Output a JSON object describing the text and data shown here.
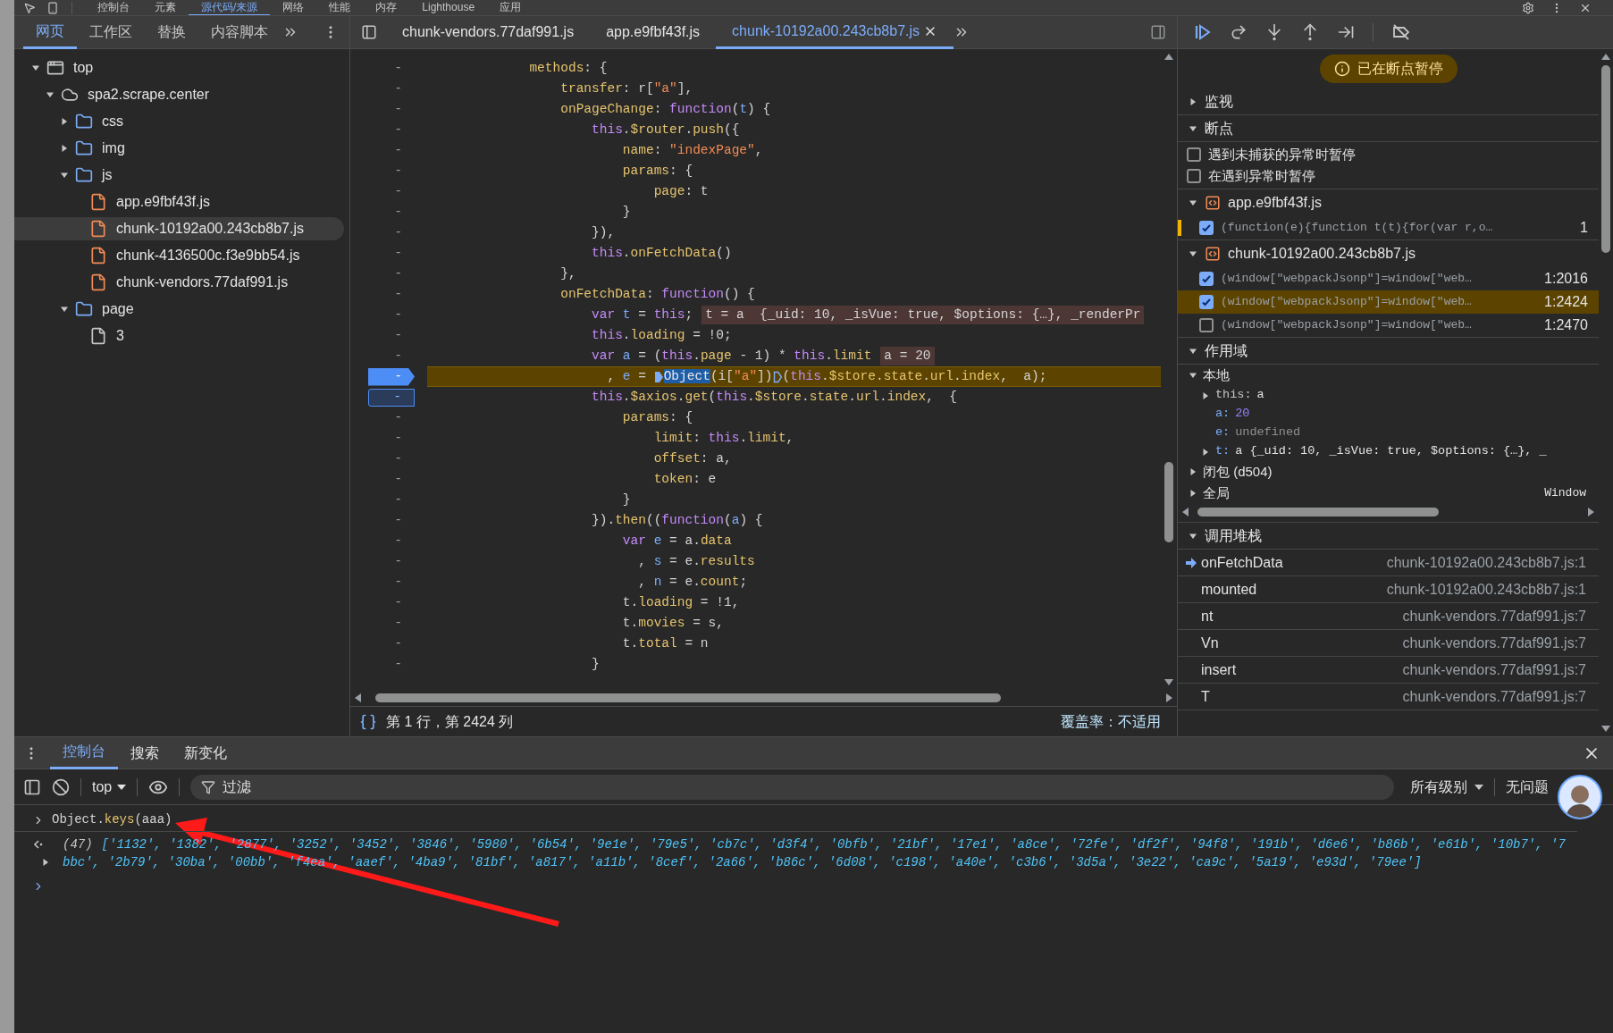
{
  "topbar": {
    "tabs": [
      {
        "label": "控制台",
        "selected": false
      },
      {
        "label": "元素",
        "selected": false
      },
      {
        "label": "源代码/来源",
        "selected": true
      },
      {
        "label": "网络",
        "selected": false
      },
      {
        "label": "性能",
        "selected": false
      },
      {
        "label": "内存",
        "selected": false
      },
      {
        "label": "Lighthouse",
        "selected": false
      },
      {
        "label": "应用",
        "selected": false
      }
    ]
  },
  "navigator": {
    "tabs": [
      {
        "label": "网页",
        "selected": true
      },
      {
        "label": "工作区",
        "selected": false
      },
      {
        "label": "替换",
        "selected": false
      },
      {
        "label": "内容脚本",
        "selected": false
      }
    ],
    "tree": [
      {
        "label": "top",
        "kind": "frame",
        "expanded": true,
        "selected": false,
        "children": [
          {
            "label": "spa2.scrape.center",
            "kind": "domain",
            "expanded": true,
            "selected": false,
            "children": [
              {
                "label": "css",
                "kind": "folder",
                "expanded": false,
                "selected": false
              },
              {
                "label": "img",
                "kind": "folder",
                "expanded": false,
                "selected": false
              },
              {
                "label": "js",
                "kind": "folder",
                "expanded": true,
                "selected": false,
                "children": [
                  {
                    "label": "app.e9fbf43f.js",
                    "kind": "script",
                    "selected": false
                  },
                  {
                    "label": "chunk-10192a00.243cb8b7.js",
                    "kind": "script",
                    "selected": true
                  },
                  {
                    "label": "chunk-4136500c.f3e9bb54.js",
                    "kind": "script",
                    "selected": false
                  },
                  {
                    "label": "chunk-vendors.77daf991.js",
                    "kind": "script",
                    "selected": false
                  }
                ]
              },
              {
                "label": "page",
                "kind": "folder",
                "expanded": true,
                "selected": false,
                "children": [
                  {
                    "label": "3",
                    "kind": "document",
                    "selected": false
                  }
                ]
              }
            ]
          }
        ]
      }
    ]
  },
  "editor": {
    "tabs": [
      {
        "label": "chunk-vendors.77daf991.js",
        "selected": false
      },
      {
        "label": "app.e9fbf43f.js",
        "selected": false
      },
      {
        "label": "chunk-10192a00.243cb8b7.js",
        "selected": true
      }
    ],
    "lines": [
      {
        "gutter": "-",
        "paused": false,
        "tokens": [
          {
            "text": "            methods",
            "kind": "prop"
          },
          {
            "text": ": {",
            "kind": "plain"
          }
        ]
      },
      {
        "gutter": "-",
        "paused": false,
        "tokens": [
          {
            "text": "                transfer",
            "kind": "prop"
          },
          {
            "text": ": r[",
            "kind": "plain"
          },
          {
            "text": "\"a\"",
            "kind": "string"
          },
          {
            "text": "],",
            "kind": "plain"
          }
        ]
      },
      {
        "gutter": "-",
        "paused": false,
        "tokens": [
          {
            "text": "                onPageChange",
            "kind": "prop"
          },
          {
            "text": ": ",
            "kind": "plain"
          },
          {
            "text": "function",
            "kind": "keyword"
          },
          {
            "text": "(",
            "kind": "plain"
          },
          {
            "text": "t",
            "kind": "variable"
          },
          {
            "text": ") {",
            "kind": "plain"
          }
        ]
      },
      {
        "gutter": "-",
        "paused": false,
        "tokens": [
          {
            "text": "                    this",
            "kind": "keyword"
          },
          {
            "text": ".",
            "kind": "plain"
          },
          {
            "text": "$router",
            "kind": "prop"
          },
          {
            "text": ".",
            "kind": "plain"
          },
          {
            "text": "push",
            "kind": "prop"
          },
          {
            "text": "({",
            "kind": "plain"
          }
        ]
      },
      {
        "gutter": "-",
        "paused": false,
        "tokens": [
          {
            "text": "                        name",
            "kind": "prop"
          },
          {
            "text": ": ",
            "kind": "plain"
          },
          {
            "text": "\"indexPage\"",
            "kind": "string"
          },
          {
            "text": ",",
            "kind": "plain"
          }
        ]
      },
      {
        "gutter": "-",
        "paused": false,
        "tokens": [
          {
            "text": "                        params",
            "kind": "prop"
          },
          {
            "text": ": {",
            "kind": "plain"
          }
        ]
      },
      {
        "gutter": "-",
        "paused": false,
        "tokens": [
          {
            "text": "                            page",
            "kind": "prop"
          },
          {
            "text": ": t",
            "kind": "plain"
          }
        ]
      },
      {
        "gutter": "-",
        "paused": false,
        "tokens": [
          {
            "text": "                        }",
            "kind": "plain"
          }
        ]
      },
      {
        "gutter": "-",
        "paused": false,
        "tokens": [
          {
            "text": "                    }),",
            "kind": "plain"
          }
        ]
      },
      {
        "gutter": "-",
        "paused": false,
        "tokens": [
          {
            "text": "                    this",
            "kind": "keyword"
          },
          {
            "text": ".",
            "kind": "plain"
          },
          {
            "text": "onFetchData",
            "kind": "prop"
          },
          {
            "text": "()",
            "kind": "plain"
          }
        ]
      },
      {
        "gutter": "-",
        "paused": false,
        "tokens": [
          {
            "text": "                },",
            "kind": "plain"
          }
        ]
      },
      {
        "gutter": "-",
        "paused": false,
        "tokens": [
          {
            "text": "                onFetchData",
            "kind": "prop"
          },
          {
            "text": ": ",
            "kind": "plain"
          },
          {
            "text": "function",
            "kind": "keyword"
          },
          {
            "text": "() {",
            "kind": "plain"
          }
        ]
      },
      {
        "gutter": "-",
        "paused": false,
        "tokens": [
          {
            "text": "                    var",
            "kind": "keyword"
          },
          {
            "text": " t",
            "kind": "variable"
          },
          {
            "text": " = ",
            "kind": "plain"
          },
          {
            "text": "this",
            "kind": "keyword"
          },
          {
            "text": ";",
            "kind": "plain"
          },
          {
            "text": "t = a  {_uid: 10, _isVue: true, $options: {…}, _renderPr",
            "kind": "inline"
          }
        ]
      },
      {
        "gutter": "-",
        "paused": false,
        "tokens": [
          {
            "text": "                    this",
            "kind": "keyword"
          },
          {
            "text": ".",
            "kind": "plain"
          },
          {
            "text": "loading",
            "kind": "prop"
          },
          {
            "text": " = !0;",
            "kind": "plain"
          }
        ]
      },
      {
        "gutter": "-",
        "paused": false,
        "tokens": [
          {
            "text": "                    var",
            "kind": "keyword"
          },
          {
            "text": " a",
            "kind": "variable"
          },
          {
            "text": " = (",
            "kind": "plain"
          },
          {
            "text": "this",
            "kind": "keyword"
          },
          {
            "text": ".",
            "kind": "plain"
          },
          {
            "text": "page",
            "kind": "prop"
          },
          {
            "text": " - 1) * ",
            "kind": "plain"
          },
          {
            "text": "this",
            "kind": "keyword"
          },
          {
            "text": ".",
            "kind": "plain"
          },
          {
            "text": "limit",
            "kind": "prop"
          },
          {
            "text": "a = 20",
            "kind": "inline"
          }
        ]
      },
      {
        "gutter": "-",
        "breakpoint_enabled": true,
        "paused": true,
        "tokens": [
          {
            "text": "                      , ",
            "kind": "plain"
          },
          {
            "text": "e",
            "kind": "variable"
          },
          {
            "text": " = ",
            "kind": "plain"
          },
          {
            "kind": "marker",
            "active": true
          },
          {
            "text": "Object",
            "kind": "selected"
          },
          {
            "text": "(i[",
            "kind": "plain"
          },
          {
            "text": "\"a\"",
            "kind": "string"
          },
          {
            "text": "])",
            "kind": "plain"
          },
          {
            "kind": "marker",
            "active": false
          },
          {
            "text": "(",
            "kind": "plain"
          },
          {
            "text": "this",
            "kind": "keyword"
          },
          {
            "text": ".",
            "kind": "plain"
          },
          {
            "text": "$store",
            "kind": "prop"
          },
          {
            "text": ".",
            "kind": "plain"
          },
          {
            "text": "state",
            "kind": "prop"
          },
          {
            "text": ".",
            "kind": "plain"
          },
          {
            "text": "url",
            "kind": "prop"
          },
          {
            "text": ".",
            "kind": "plain"
          },
          {
            "text": "index",
            "kind": "prop"
          },
          {
            "text": ",  a);",
            "kind": "plain"
          }
        ]
      },
      {
        "gutter": "-",
        "breakpoint_enabled": false,
        "paused": false,
        "tokens": [
          {
            "text": "                    this",
            "kind": "keyword"
          },
          {
            "text": ".",
            "kind": "plain"
          },
          {
            "text": "$axios",
            "kind": "prop"
          },
          {
            "text": ".",
            "kind": "plain"
          },
          {
            "text": "get",
            "kind": "prop"
          },
          {
            "text": "(",
            "kind": "plain"
          },
          {
            "text": "this",
            "kind": "keyword"
          },
          {
            "text": ".",
            "kind": "plain"
          },
          {
            "text": "$store",
            "kind": "prop"
          },
          {
            "text": ".",
            "kind": "plain"
          },
          {
            "text": "state",
            "kind": "prop"
          },
          {
            "text": ".",
            "kind": "plain"
          },
          {
            "text": "url",
            "kind": "prop"
          },
          {
            "text": ".",
            "kind": "plain"
          },
          {
            "text": "index",
            "kind": "prop"
          },
          {
            "text": ",  {",
            "kind": "plain"
          }
        ]
      },
      {
        "gutter": "-",
        "paused": false,
        "tokens": [
          {
            "text": "                        params",
            "kind": "prop"
          },
          {
            "text": ": {",
            "kind": "plain"
          }
        ]
      },
      {
        "gutter": "-",
        "paused": false,
        "tokens": [
          {
            "text": "                            limit",
            "kind": "prop"
          },
          {
            "text": ": ",
            "kind": "plain"
          },
          {
            "text": "this",
            "kind": "keyword"
          },
          {
            "text": ".",
            "kind": "plain"
          },
          {
            "text": "limit",
            "kind": "prop"
          },
          {
            "text": ",",
            "kind": "plain"
          }
        ]
      },
      {
        "gutter": "-",
        "paused": false,
        "tokens": [
          {
            "text": "                            offset",
            "kind": "prop"
          },
          {
            "text": ": a,",
            "kind": "plain"
          }
        ]
      },
      {
        "gutter": "-",
        "paused": false,
        "tokens": [
          {
            "text": "                            token",
            "kind": "prop"
          },
          {
            "text": ": e",
            "kind": "plain"
          }
        ]
      },
      {
        "gutter": "-",
        "paused": false,
        "tokens": [
          {
            "text": "                        }",
            "kind": "plain"
          }
        ]
      },
      {
        "gutter": "-",
        "paused": false,
        "tokens": [
          {
            "text": "                    }).",
            "kind": "plain"
          },
          {
            "text": "then",
            "kind": "prop"
          },
          {
            "text": "((",
            "kind": "plain"
          },
          {
            "text": "function",
            "kind": "keyword"
          },
          {
            "text": "(",
            "kind": "plain"
          },
          {
            "text": "a",
            "kind": "variable"
          },
          {
            "text": ") {",
            "kind": "plain"
          }
        ]
      },
      {
        "gutter": "-",
        "paused": false,
        "tokens": [
          {
            "text": "                        var",
            "kind": "keyword"
          },
          {
            "text": " e",
            "kind": "variable"
          },
          {
            "text": " = a.",
            "kind": "plain"
          },
          {
            "text": "data",
            "kind": "prop"
          }
        ]
      },
      {
        "gutter": "-",
        "paused": false,
        "tokens": [
          {
            "text": "                          , ",
            "kind": "plain"
          },
          {
            "text": "s",
            "kind": "variable"
          },
          {
            "text": " = e.",
            "kind": "plain"
          },
          {
            "text": "results",
            "kind": "prop"
          }
        ]
      },
      {
        "gutter": "-",
        "paused": false,
        "tokens": [
          {
            "text": "                          , ",
            "kind": "plain"
          },
          {
            "text": "n",
            "kind": "variable"
          },
          {
            "text": " = e.",
            "kind": "plain"
          },
          {
            "text": "count",
            "kind": "prop"
          },
          {
            "text": ";",
            "kind": "plain"
          }
        ]
      },
      {
        "gutter": "-",
        "paused": false,
        "tokens": [
          {
            "text": "                        t.",
            "kind": "plain"
          },
          {
            "text": "loading",
            "kind": "prop"
          },
          {
            "text": " = !1,",
            "kind": "plain"
          }
        ]
      },
      {
        "gutter": "-",
        "paused": false,
        "tokens": [
          {
            "text": "                        t.",
            "kind": "plain"
          },
          {
            "text": "movies",
            "kind": "prop"
          },
          {
            "text": " = s,",
            "kind": "plain"
          }
        ]
      },
      {
        "gutter": "-",
        "paused": false,
        "tokens": [
          {
            "text": "                        t.",
            "kind": "plain"
          },
          {
            "text": "total",
            "kind": "prop"
          },
          {
            "text": " = n",
            "kind": "plain"
          }
        ]
      },
      {
        "gutter": "-",
        "paused": false,
        "tokens": [
          {
            "text": "                    }",
            "kind": "plain"
          }
        ]
      }
    ],
    "status": {
      "position": "第 1 行，第 2424 列",
      "coverage": "覆盖率：不适用"
    }
  },
  "debugger": {
    "paused_badge": "已在断点暂停",
    "watch": {
      "title": "监视",
      "expanded": false
    },
    "breakpoints": {
      "title": "断点",
      "expanded": true,
      "options": [
        {
          "label": "遇到未捕获的异常时暂停",
          "checked": false
        },
        {
          "label": "在遇到异常时暂停",
          "checked": false
        }
      ],
      "files": [
        {
          "name": "app.e9fbf43f.js",
          "expanded": true,
          "items": [
            {
              "code": "(function(e){function t(t){for(var r,o…",
              "location": "1",
              "checked": true,
              "selected": false,
              "marked": true
            }
          ]
        },
        {
          "name": "chunk-10192a00.243cb8b7.js",
          "expanded": true,
          "items": [
            {
              "code": "(window[\"webpackJsonp\"]=window[\"web…",
              "location": "1:2016",
              "checked": true,
              "selected": false,
              "marked": false
            },
            {
              "code": "(window[\"webpackJsonp\"]=window[\"web…",
              "location": "1:2424",
              "checked": true,
              "selected": true,
              "marked": false
            },
            {
              "code": "(window[\"webpackJsonp\"]=window[\"web…",
              "location": "1:2470",
              "checked": false,
              "selected": false,
              "marked": false
            }
          ]
        }
      ]
    },
    "scope": {
      "title": "作用域",
      "expanded": true,
      "groups": [
        {
          "label": "本地",
          "expanded": true,
          "vars": [
            {
              "name": "this:",
              "value": "a",
              "kind": "object",
              "expandable": true
            },
            {
              "name": "a:",
              "value": "20",
              "kind": "number",
              "expandable": false
            },
            {
              "name": "e:",
              "value": "undefined",
              "kind": "undefined",
              "expandable": false
            },
            {
              "name": "t:",
              "value": "a  {_uid: 10, _isVue: true, $options: {…}, _",
              "kind": "object",
              "expandable": true
            }
          ]
        },
        {
          "label": "闭包 (d504)",
          "expanded": false
        },
        {
          "label": "全局",
          "expanded": false,
          "value": "Window"
        }
      ]
    },
    "callstack": {
      "title": "调用堆栈",
      "expanded": true,
      "frames": [
        {
          "name": "onFetchData",
          "location": "chunk-10192a00.243cb8b7.js:1",
          "selected": true
        },
        {
          "name": "mounted",
          "location": "chunk-10192a00.243cb8b7.js:1",
          "selected": false
        },
        {
          "name": "nt",
          "location": "chunk-vendors.77daf991.js:7",
          "selected": false
        },
        {
          "name": "Vn",
          "location": "chunk-vendors.77daf991.js:7",
          "selected": false
        },
        {
          "name": "insert",
          "location": "chunk-vendors.77daf991.js:7",
          "selected": false
        },
        {
          "name": "T",
          "location": "chunk-vendors.77daf991.js:7",
          "selected": false
        }
      ]
    }
  },
  "console": {
    "tabs": [
      {
        "label": "控制台",
        "selected": true
      },
      {
        "label": "搜索",
        "selected": false
      },
      {
        "label": "新变化",
        "selected": false
      }
    ],
    "context": "top",
    "filter": {
      "placeholder": "过滤"
    },
    "levels": "所有级别",
    "issues": "无问题",
    "entries": [
      {
        "kind": "input",
        "tokens": [
          {
            "text": "Object.",
            "kind": "plain"
          },
          {
            "text": "keys",
            "kind": "prop"
          },
          {
            "text": "(aaa)",
            "kind": "plain"
          }
        ]
      },
      {
        "kind": "result",
        "count": "(47)",
        "value": "['1132', '1382', '2877', '3252', '3452', '3846', '5980', '6b54', '9e1e', '79e5', 'cb7c', 'd3f4', '0bfb', '21bf', '17e1', 'a8ce', '72fe', 'df2f', '94f8', '191b', 'd6e6', 'b86b', 'e61b', '10b7', '7bbc', '2b79', '30ba', '00bb', 'f4ea', 'aaef', '4ba9', '81bf', 'a817', 'a11b', '8cef', '2a66', 'b86c', '6d08', 'c198', 'a40e', 'c3b6', '3d5a', '3e22', 'ca9c', '5a19', 'e93d', '79ee']"
      }
    ]
  },
  "annotation": {
    "kind": "arrow"
  }
}
